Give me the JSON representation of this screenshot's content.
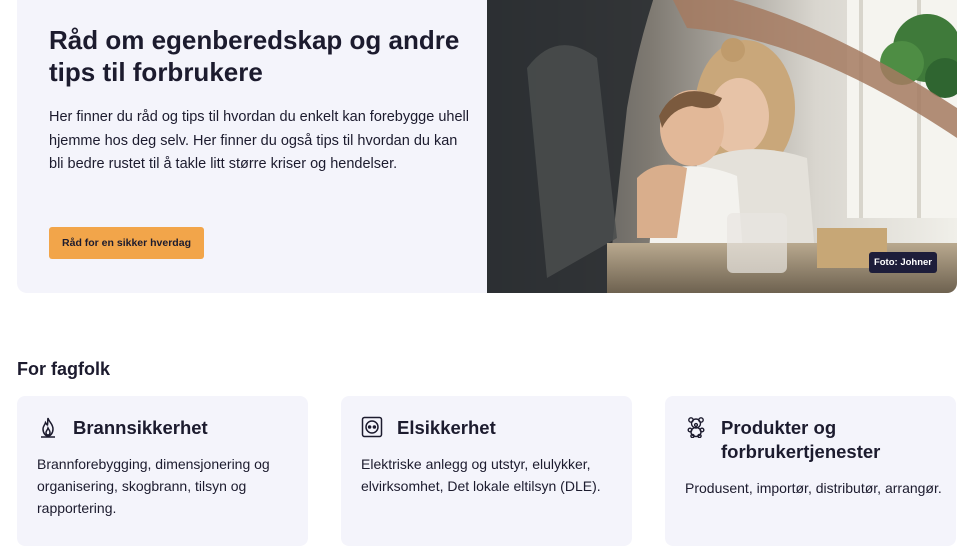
{
  "hero": {
    "title": "Råd om egenberedskap og andre tips til forbrukere",
    "body": "Her finner du råd og tips til hvordan du enkelt kan forebygge uhell hjemme hos deg selv. Her finner du også tips til hvordan du kan bli bedre rustet til å takle litt større kriser og hendelser.",
    "button_label": "Råd for en sikker hverdag",
    "photo_credit": "Foto: Johner",
    "photo_alt": "Mor og sønn som klemmer ved kjøkkenbordet"
  },
  "colors": {
    "background": "#ffffff",
    "panel": "#f4f4fb",
    "button": "#f2a54a",
    "text": "#1c1b2e",
    "credit_badge": "#1d1d3a"
  },
  "section": {
    "title": "For fagfolk"
  },
  "cards": [
    {
      "icon": "flame-icon",
      "title": "Brannsikkerhet",
      "description": "Brannforebygging, dimensjonering og organisering, skogbrann, tilsyn og rapportering."
    },
    {
      "icon": "power-outlet-icon",
      "title": "Elsikkerhet",
      "description": "Elektriske anlegg og utstyr, elulykker, elvirksomhet, Det lokale eltilsyn (DLE)."
    },
    {
      "icon": "teddy-bear-icon",
      "title": "Produkter og forbrukertjenester",
      "description": "Produsent, importør, distributør, arrangør."
    }
  ]
}
